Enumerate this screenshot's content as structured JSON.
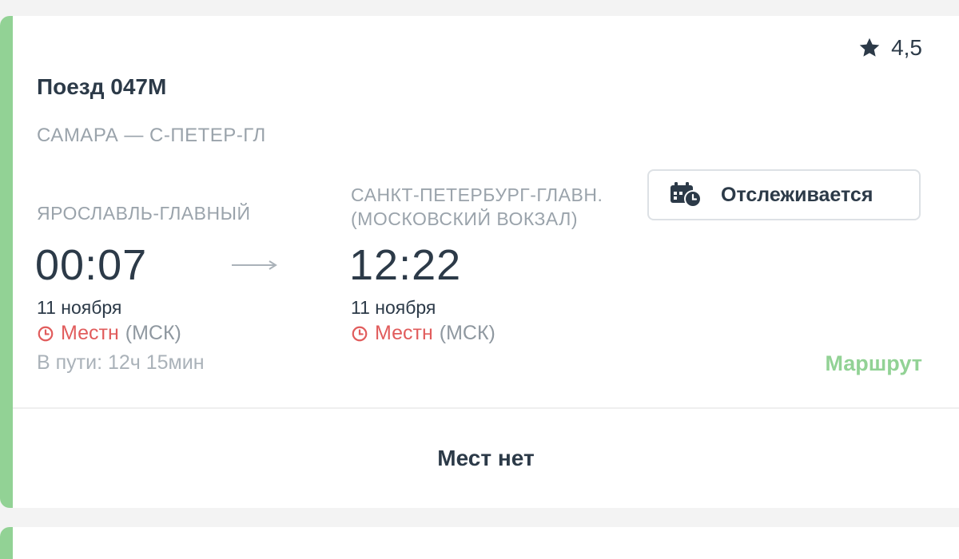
{
  "card": {
    "rating": "4,5",
    "train_title": "Поезд 047М",
    "route": "САМАРА — С-ПЕТЕР-ГЛ",
    "departure": {
      "station": "ЯРОСЛАВЛЬ-ГЛАВНЫЙ",
      "time": "00:07",
      "date": "11 ноября",
      "tz_local": "Местн",
      "tz_msk": "(МСК)"
    },
    "arrival": {
      "station_line1": "САНКТ-ПЕТЕРБУРГ-ГЛАВН.",
      "station_line2": "(МОСКОВСКИЙ ВОКЗАЛ)",
      "time": "12:22",
      "date": "11 ноября",
      "tz_local": "Местн",
      "tz_msk": "(МСК)"
    },
    "track_button_label": "Отслеживается",
    "duration": "В пути: 12ч 15мин",
    "route_link": "Маршрут",
    "seats_status": "Мест нет"
  },
  "colors": {
    "accent_green": "#92d295",
    "text_dark": "#2c3a48",
    "text_gray": "#9aa3ab",
    "local_time_red": "#e15c5c"
  },
  "icons": {
    "rating": "star-icon",
    "timezone": "clock-icon",
    "tracking": "calendar-clock-icon",
    "direction": "arrow-right-icon"
  }
}
